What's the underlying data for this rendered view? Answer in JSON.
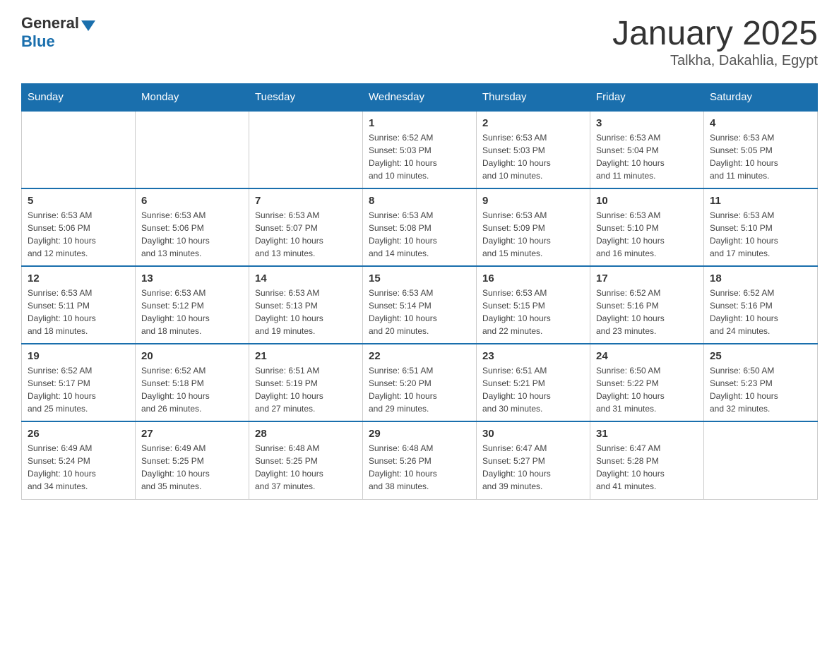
{
  "header": {
    "logo_general": "General",
    "logo_blue": "Blue",
    "title": "January 2025",
    "subtitle": "Talkha, Dakahlia, Egypt"
  },
  "days_of_week": [
    "Sunday",
    "Monday",
    "Tuesday",
    "Wednesday",
    "Thursday",
    "Friday",
    "Saturday"
  ],
  "weeks": [
    [
      {
        "day": "",
        "info": ""
      },
      {
        "day": "",
        "info": ""
      },
      {
        "day": "",
        "info": ""
      },
      {
        "day": "1",
        "info": "Sunrise: 6:52 AM\nSunset: 5:03 PM\nDaylight: 10 hours\nand 10 minutes."
      },
      {
        "day": "2",
        "info": "Sunrise: 6:53 AM\nSunset: 5:03 PM\nDaylight: 10 hours\nand 10 minutes."
      },
      {
        "day": "3",
        "info": "Sunrise: 6:53 AM\nSunset: 5:04 PM\nDaylight: 10 hours\nand 11 minutes."
      },
      {
        "day": "4",
        "info": "Sunrise: 6:53 AM\nSunset: 5:05 PM\nDaylight: 10 hours\nand 11 minutes."
      }
    ],
    [
      {
        "day": "5",
        "info": "Sunrise: 6:53 AM\nSunset: 5:06 PM\nDaylight: 10 hours\nand 12 minutes."
      },
      {
        "day": "6",
        "info": "Sunrise: 6:53 AM\nSunset: 5:06 PM\nDaylight: 10 hours\nand 13 minutes."
      },
      {
        "day": "7",
        "info": "Sunrise: 6:53 AM\nSunset: 5:07 PM\nDaylight: 10 hours\nand 13 minutes."
      },
      {
        "day": "8",
        "info": "Sunrise: 6:53 AM\nSunset: 5:08 PM\nDaylight: 10 hours\nand 14 minutes."
      },
      {
        "day": "9",
        "info": "Sunrise: 6:53 AM\nSunset: 5:09 PM\nDaylight: 10 hours\nand 15 minutes."
      },
      {
        "day": "10",
        "info": "Sunrise: 6:53 AM\nSunset: 5:10 PM\nDaylight: 10 hours\nand 16 minutes."
      },
      {
        "day": "11",
        "info": "Sunrise: 6:53 AM\nSunset: 5:10 PM\nDaylight: 10 hours\nand 17 minutes."
      }
    ],
    [
      {
        "day": "12",
        "info": "Sunrise: 6:53 AM\nSunset: 5:11 PM\nDaylight: 10 hours\nand 18 minutes."
      },
      {
        "day": "13",
        "info": "Sunrise: 6:53 AM\nSunset: 5:12 PM\nDaylight: 10 hours\nand 18 minutes."
      },
      {
        "day": "14",
        "info": "Sunrise: 6:53 AM\nSunset: 5:13 PM\nDaylight: 10 hours\nand 19 minutes."
      },
      {
        "day": "15",
        "info": "Sunrise: 6:53 AM\nSunset: 5:14 PM\nDaylight: 10 hours\nand 20 minutes."
      },
      {
        "day": "16",
        "info": "Sunrise: 6:53 AM\nSunset: 5:15 PM\nDaylight: 10 hours\nand 22 minutes."
      },
      {
        "day": "17",
        "info": "Sunrise: 6:52 AM\nSunset: 5:16 PM\nDaylight: 10 hours\nand 23 minutes."
      },
      {
        "day": "18",
        "info": "Sunrise: 6:52 AM\nSunset: 5:16 PM\nDaylight: 10 hours\nand 24 minutes."
      }
    ],
    [
      {
        "day": "19",
        "info": "Sunrise: 6:52 AM\nSunset: 5:17 PM\nDaylight: 10 hours\nand 25 minutes."
      },
      {
        "day": "20",
        "info": "Sunrise: 6:52 AM\nSunset: 5:18 PM\nDaylight: 10 hours\nand 26 minutes."
      },
      {
        "day": "21",
        "info": "Sunrise: 6:51 AM\nSunset: 5:19 PM\nDaylight: 10 hours\nand 27 minutes."
      },
      {
        "day": "22",
        "info": "Sunrise: 6:51 AM\nSunset: 5:20 PM\nDaylight: 10 hours\nand 29 minutes."
      },
      {
        "day": "23",
        "info": "Sunrise: 6:51 AM\nSunset: 5:21 PM\nDaylight: 10 hours\nand 30 minutes."
      },
      {
        "day": "24",
        "info": "Sunrise: 6:50 AM\nSunset: 5:22 PM\nDaylight: 10 hours\nand 31 minutes."
      },
      {
        "day": "25",
        "info": "Sunrise: 6:50 AM\nSunset: 5:23 PM\nDaylight: 10 hours\nand 32 minutes."
      }
    ],
    [
      {
        "day": "26",
        "info": "Sunrise: 6:49 AM\nSunset: 5:24 PM\nDaylight: 10 hours\nand 34 minutes."
      },
      {
        "day": "27",
        "info": "Sunrise: 6:49 AM\nSunset: 5:25 PM\nDaylight: 10 hours\nand 35 minutes."
      },
      {
        "day": "28",
        "info": "Sunrise: 6:48 AM\nSunset: 5:25 PM\nDaylight: 10 hours\nand 37 minutes."
      },
      {
        "day": "29",
        "info": "Sunrise: 6:48 AM\nSunset: 5:26 PM\nDaylight: 10 hours\nand 38 minutes."
      },
      {
        "day": "30",
        "info": "Sunrise: 6:47 AM\nSunset: 5:27 PM\nDaylight: 10 hours\nand 39 minutes."
      },
      {
        "day": "31",
        "info": "Sunrise: 6:47 AM\nSunset: 5:28 PM\nDaylight: 10 hours\nand 41 minutes."
      },
      {
        "day": "",
        "info": ""
      }
    ]
  ]
}
